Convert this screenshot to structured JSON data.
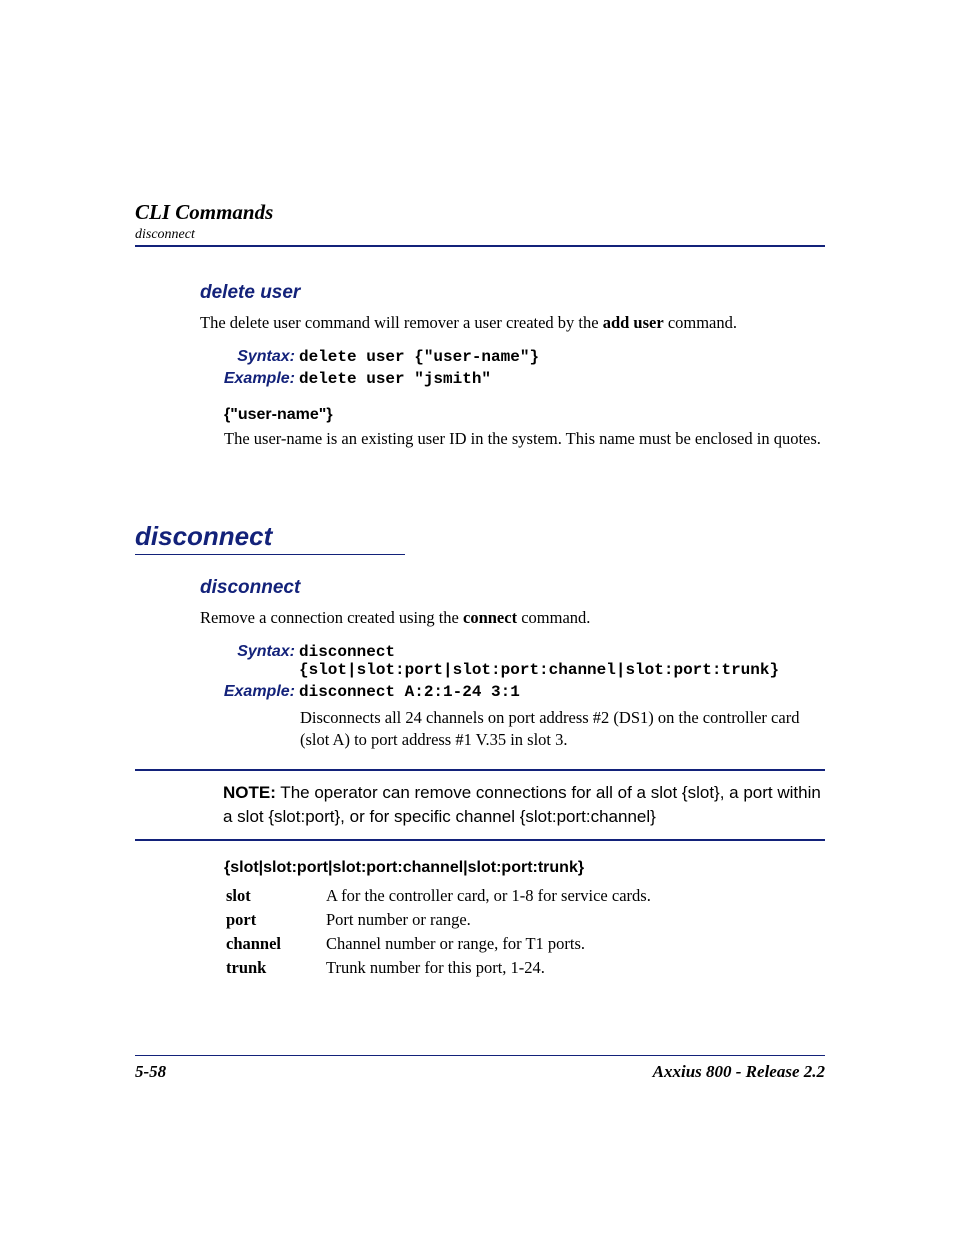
{
  "header": {
    "title": "CLI Commands",
    "subtitle": "disconnect"
  },
  "s1": {
    "heading": "delete user",
    "intro_a": "The delete user command will remover a user created by the ",
    "intro_bold": "add user",
    "intro_b": " command.",
    "syntax_label": "Syntax:",
    "syntax_code": "delete user {\"user-name\"}",
    "example_label": "Example:",
    "example_code": "delete user \"jsmith\"",
    "arg_head": "{\"user-name\"}",
    "arg_text": "The user-name is an existing user ID in the system. This name must be enclosed in quotes."
  },
  "h2": "disconnect",
  "s2": {
    "heading": "disconnect",
    "intro_a": "Remove a connection created using the ",
    "intro_bold": "connect",
    "intro_b": " command.",
    "syntax_label": "Syntax:",
    "syntax_code": "disconnect {slot|slot:port|slot:port:channel|slot:port:trunk}",
    "example_label": "Example:",
    "example_code": "disconnect A:2:1-24 3:1",
    "example_desc": "Disconnects all 24 channels on port address #2 (DS1) on the controller card (slot A) to port address #1 V.35 in slot 3.",
    "note_label": "NOTE:",
    "note_text": "  The operator can remove connections for all of a  slot {slot}, a port within a slot {slot:port}, or for specific channel {slot:port:channel}",
    "arg_head": "{slot|slot:port|slot:port:channel|slot:port:trunk}",
    "params": [
      {
        "k": "slot",
        "v": "A for the controller card, or 1-8 for service cards."
      },
      {
        "k": "port",
        "v": "Port number or range."
      },
      {
        "k": "channel",
        "v": "Channel number or range, for T1 ports."
      },
      {
        "k": "trunk",
        "v": "Trunk number for this port, 1-24."
      }
    ]
  },
  "footer": {
    "left": "5-58",
    "right": "Axxius 800 - Release 2.2"
  }
}
